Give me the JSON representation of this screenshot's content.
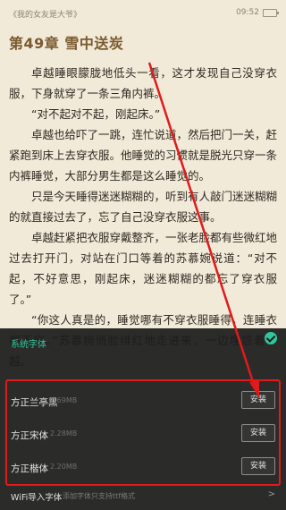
{
  "status_bar": {
    "book_title": "《我的女友是大爷》",
    "time": "09:52"
  },
  "chapter": {
    "title": "第49章 雪中送炭"
  },
  "paragraphs": [
    "卓越睡眼朦胧地低头一看，这才发现自己没穿衣服，下身就穿了一条三角内裤。",
    "“对不起对不起，刚起床。”",
    "卓越也给吓了一跳，连忙说道，然后把门一关，赶紧跑到床上去穿衣服。他睡觉的习惯就是脱光只穿一条内裤睡觉，大部分男生都是这么睡觉的。",
    "只是今天睡得迷迷糊糊的，听到有人敲门迷迷糊糊的就直接过去了，忘了自己没穿衣服这事。",
    "卓越赶紧把衣服穿戴整齐，一张老脸都有些微红地过去打开门，对站在门口等着的苏慕婉说道：“对不起，不好意思，刚起床，迷迷糊糊的都忘了穿衣服了。”",
    "“你这人真是的，睡觉哪有不穿衣服睡得，连睡衣都不穿。”苏慕婉俏脸绯红地走进来，一边埋怨着卓越。"
  ],
  "font_panel": {
    "section_title": "系统字体",
    "fonts": [
      {
        "name": "方正兰亭黑",
        "size": "1.69MB",
        "button": "安装"
      },
      {
        "name": "方正宋体",
        "size": "2.28MB",
        "button": "安装"
      },
      {
        "name": "方正楷体",
        "size": "2.20MB",
        "button": "安装"
      }
    ],
    "wifi_label": "WiFi导入字体",
    "wifi_sub": "添加字体只支持ttf格式",
    "wifi_arrow": ">"
  }
}
